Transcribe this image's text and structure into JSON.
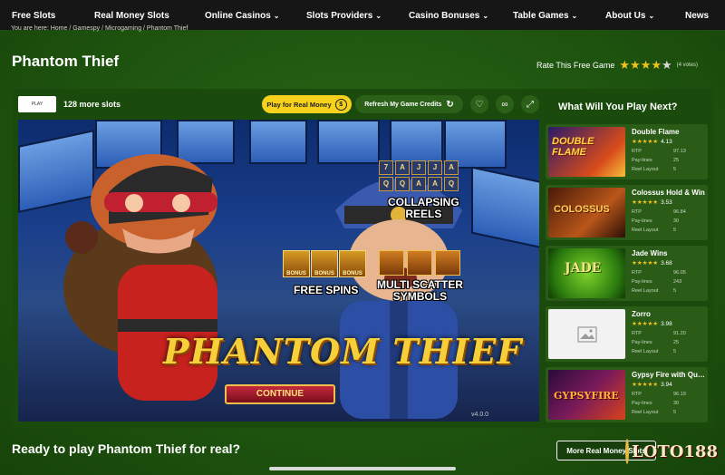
{
  "nav": [
    {
      "label": "Free Slots",
      "dropdown": false
    },
    {
      "label": "Real Money Slots",
      "dropdown": false
    },
    {
      "label": "Online Casinos",
      "dropdown": true
    },
    {
      "label": "Slots Providers",
      "dropdown": true
    },
    {
      "label": "Casino Bonuses",
      "dropdown": true
    },
    {
      "label": "Table Games",
      "dropdown": true
    },
    {
      "label": "About Us",
      "dropdown": true
    },
    {
      "label": "News",
      "dropdown": false
    }
  ],
  "breadcrumb": "You are here: Home / Gamespy / Microgaming / Phantom Thief",
  "page_title": "Phantom Thief",
  "rating": {
    "label": "Rate This Free Game",
    "stars": 4,
    "max": 5,
    "votes": "(4 votes)"
  },
  "toolbar": {
    "provider_logo": "PLAY",
    "more_slots": "128 more slots",
    "play_real_label": "Play for Real Money",
    "refresh_label": "Refresh My Game Credits"
  },
  "game": {
    "title": "PHANTOM THIEF",
    "continue_label": "CONTINUE",
    "feature_reels": "COLLAPSING\nREELS",
    "feature_spins": "FREE SPINS",
    "feature_scatter": "MULTI SCATTER\nSYMBOLS",
    "bonus_label": "BONUS",
    "version": "v4.0.0"
  },
  "sidebar": {
    "title": "What Will You Play Next?",
    "meta_labels": {
      "rtp": "RTP",
      "paylines": "Pay-lines",
      "layout": "Reel Layout"
    },
    "games": [
      {
        "name": "Double Flame",
        "rating": "4.13",
        "rtp": "97.13",
        "paylines": "25",
        "layout": "5",
        "thumb": "double-flame"
      },
      {
        "name": "Colossus Hold & Win",
        "rating": "3.53",
        "rtp": "96.84",
        "paylines": "30",
        "layout": "5",
        "thumb": "colossus"
      },
      {
        "name": "Jade Wins",
        "rating": "3.68",
        "rtp": "96.05",
        "paylines": "243",
        "layout": "5",
        "thumb": "jade"
      },
      {
        "name": "Zorro",
        "rating": "3.98",
        "rtp": "91.20",
        "paylines": "25",
        "layout": "5",
        "thumb": "placeholder"
      },
      {
        "name": "Gypsy Fire with Quick Strike",
        "rating": "3.94",
        "rtp": "96.19",
        "paylines": "30",
        "layout": "5",
        "thumb": "gypsy"
      }
    ]
  },
  "cta": {
    "text": "Ready to play Phantom Thief for real?",
    "button": "More Real Money Slots"
  },
  "watermark": "LOTO188",
  "colors": {
    "accent": "#f7d21c",
    "background": "#1d4f0f",
    "nav": "#161616",
    "star": "#f2c21b"
  }
}
